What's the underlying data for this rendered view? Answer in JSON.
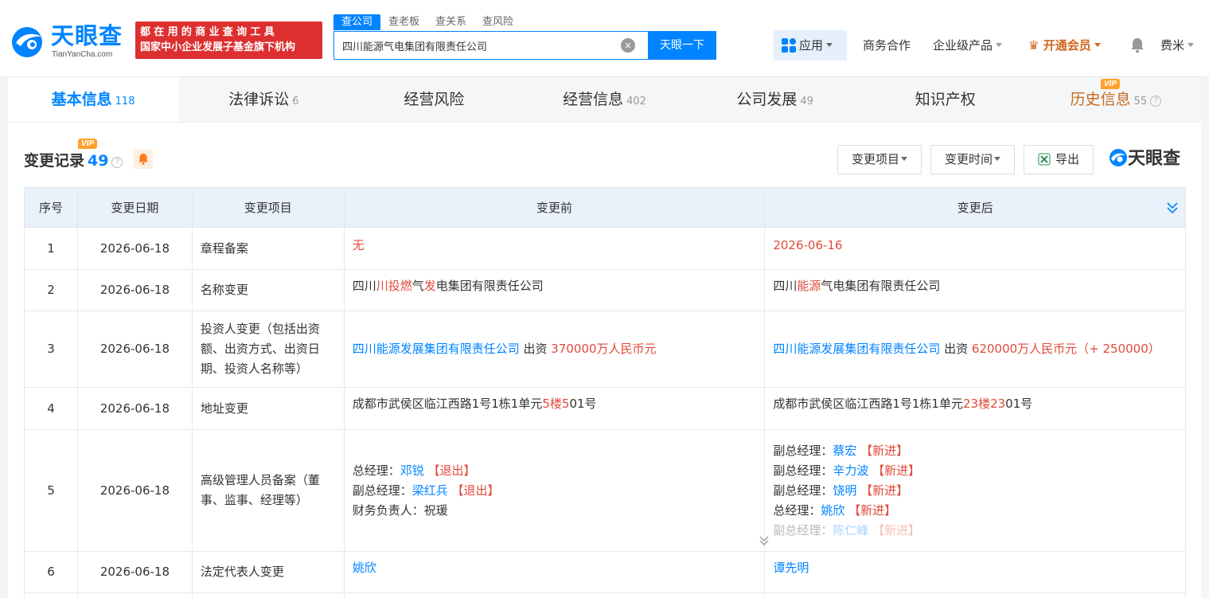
{
  "brand": {
    "name_cn": "天眼查",
    "name_en": "TianYanCha.com",
    "slogan_line1": "都在用的商业查询工具",
    "slogan_line2": "国家中小企业发展子基金旗下机构"
  },
  "search": {
    "tabs": [
      "查公司",
      "查老板",
      "查关系",
      "查风险"
    ],
    "active_tab": "查公司",
    "value": "四川能源气电集团有限责任公司",
    "clear_icon": "×",
    "button": "天眼一下"
  },
  "nav": {
    "apps": "应用",
    "business": "商务合作",
    "enterprise": "企业级产品",
    "vip": "开通会员",
    "user": "费米"
  },
  "tabs": [
    {
      "label": "基本信息",
      "count": "118"
    },
    {
      "label": "法律诉讼",
      "count": "6"
    },
    {
      "label": "经营风险",
      "count": ""
    },
    {
      "label": "经营信息",
      "count": "402"
    },
    {
      "label": "公司发展",
      "count": "49"
    },
    {
      "label": "知识产权",
      "count": ""
    },
    {
      "label": "历史信息",
      "count": "55"
    }
  ],
  "vip_label": "VIP",
  "section": {
    "title": "变更记录",
    "count": "49",
    "filter_item": "变更项目",
    "filter_time": "变更时间",
    "export": "导出",
    "brand": "天眼查"
  },
  "table": {
    "headers": [
      "序号",
      "变更日期",
      "变更项目",
      "变更前",
      "变更后"
    ],
    "rows": [
      {
        "idx": "1",
        "date": "2026-06-18",
        "item": "章程备案",
        "before": "无",
        "after": "2026-06-16"
      },
      {
        "idx": "2",
        "date": "2026-06-18",
        "item": "名称变更",
        "before": [
          "四川",
          "川投燃",
          "气",
          "发",
          "电集团有限责任公司"
        ],
        "after": [
          "四川",
          "能源",
          "气电集团有限责任公司"
        ]
      },
      {
        "idx": "3",
        "date": "2026-06-18",
        "item": "投资人变更（包括出资额、出资方式、出资日期、投资人名称等）",
        "before": {
          "company": "四川能源发展集团有限责任公司",
          "mid": " 出资 ",
          "amount": "370000万人民币元"
        },
        "after": {
          "company": "四川能源发展集团有限责任公司",
          "mid": " 出资 ",
          "amount": "620000万人民币元（+ 250000）"
        }
      },
      {
        "idx": "4",
        "date": "2026-06-18",
        "item": "地址变更",
        "before": [
          "成都市武侯区临江西路1号1栋1单元",
          "5楼5",
          "01号"
        ],
        "after": [
          "成都市武侯区临江西路1号1栋1单元",
          "23楼23",
          "01号"
        ]
      },
      {
        "idx": "5",
        "date": "2026-06-18",
        "item": "高级管理人员备案（董事、监事、经理等）",
        "before": [
          {
            "role": "总经理：",
            "name": "邓锐",
            "tag": "【退出】"
          },
          {
            "role": "副总经理：",
            "name": "梁红兵",
            "tag": "【退出】"
          },
          {
            "role": "财务负责人：",
            "name": "祝瑗",
            "tag": ""
          }
        ],
        "after": [
          {
            "role": "副总经理：",
            "name": "蔡宏",
            "tag": "【新进】"
          },
          {
            "role": "副总经理：",
            "name": "辛力波",
            "tag": "【新进】"
          },
          {
            "role": "副总经理：",
            "name": "饶明",
            "tag": "【新进】"
          },
          {
            "role": "总经理：",
            "name": "姚欣",
            "tag": "【新进】"
          },
          {
            "role": "副总经理：",
            "name": "陈仁峰",
            "tag": "【新进】"
          }
        ]
      },
      {
        "idx": "6",
        "date": "2026-06-18",
        "item": "法定代表人变更",
        "before": "姚欣",
        "after": "谭先明"
      }
    ]
  },
  "colors": {
    "accent": "#0084ff",
    "change": "#e04a3a",
    "vip": "#d4641b"
  }
}
